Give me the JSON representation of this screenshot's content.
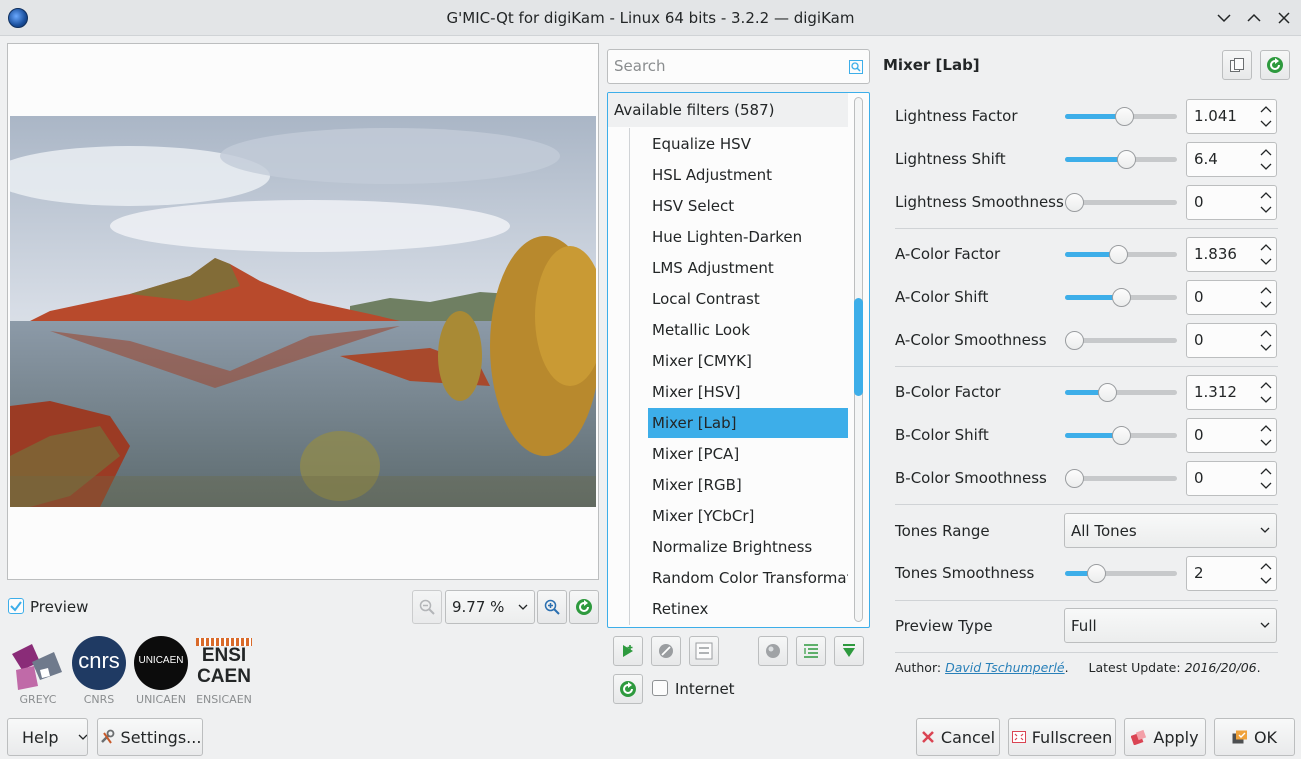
{
  "window": {
    "title": "G'MIC-Qt for digiKam - Linux 64 bits - 3.2.2 — digiKam"
  },
  "preview": {
    "checkbox_label": "Preview",
    "checked": true,
    "zoom": "9.77 %"
  },
  "logos": [
    {
      "name": "GREYC",
      "caption": "GREYC"
    },
    {
      "name": "CNRS",
      "caption": "CNRS",
      "text": "cnrs"
    },
    {
      "name": "UNICAEN",
      "caption": "UNICAEN",
      "text": "UNICAEN"
    },
    {
      "name": "ENSICAEN",
      "caption": "ENSICAEN",
      "text1": "ENSI",
      "text2": "CAEN"
    }
  ],
  "search": {
    "placeholder": "Search"
  },
  "filters": {
    "header": "Available filters (587)",
    "items": [
      "Equalize HSV",
      "HSL Adjustment",
      "HSV Select",
      "Hue Lighten-Darken",
      "LMS Adjustment",
      "Local Contrast",
      "Metallic Look",
      "Mixer [CMYK]",
      "Mixer [HSV]",
      "Mixer [Lab]",
      "Mixer [PCA]",
      "Mixer [RGB]",
      "Mixer [YCbCr]",
      "Normalize Brightness",
      "Random Color Transformation",
      "Retinex"
    ],
    "selected": "Mixer [Lab]",
    "internet_label": "Internet",
    "internet_checked": false
  },
  "params": {
    "title": "Mixer [Lab]",
    "sliders": [
      {
        "label": "Lightness Factor",
        "value": "1.041",
        "fill": 0.54
      },
      {
        "label": "Lightness Shift",
        "value": "6.4",
        "fill": 0.56
      },
      {
        "label": "Lightness Smoothness",
        "value": "0",
        "fill": 0.0
      },
      {
        "label": "A-Color Factor",
        "value": "1.836",
        "fill": 0.47
      },
      {
        "label": "A-Color Shift",
        "value": "0",
        "fill": 0.5
      },
      {
        "label": "A-Color Smoothness",
        "value": "0",
        "fill": 0.0
      },
      {
        "label": "B-Color Factor",
        "value": "1.312",
        "fill": 0.36
      },
      {
        "label": "B-Color Shift",
        "value": "0",
        "fill": 0.5
      },
      {
        "label": "B-Color Smoothness",
        "value": "0",
        "fill": 0.0
      }
    ],
    "tones_range": {
      "label": "Tones Range",
      "value": "All Tones"
    },
    "tones_smoothness": {
      "label": "Tones Smoothness",
      "value": "2",
      "fill": 0.24
    },
    "preview_type": {
      "label": "Preview Type",
      "value": "Full"
    },
    "author_prefix": "Author:",
    "author_name": "David Tschumperlé",
    "author_suffix": ".",
    "update_prefix": "Latest Update:",
    "update_date": "2016/20/06",
    "update_suffix": "."
  },
  "buttons": {
    "help": "Help",
    "settings": "Settings...",
    "cancel": "Cancel",
    "fullscreen": "Fullscreen",
    "apply": "Apply",
    "ok": "OK"
  },
  "colors": {
    "accent": "#3daee9",
    "background": "#eff0f1"
  }
}
